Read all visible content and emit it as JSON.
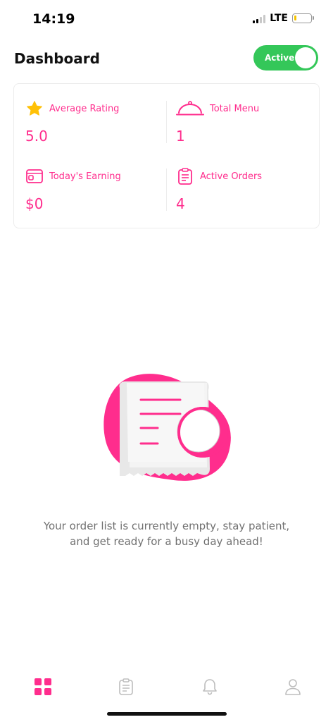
{
  "status_bar": {
    "time": "14:19",
    "network": "LTE",
    "battery_level": 0.15,
    "battery_color": "#f5c400"
  },
  "header": {
    "title": "Dashboard",
    "status_toggle": {
      "label": "Active",
      "on": true,
      "color": "#34c759"
    }
  },
  "stats": {
    "average_rating": {
      "label": "Average Rating",
      "value": "5.0",
      "icon": "star-icon"
    },
    "total_menu": {
      "label": "Total Menu",
      "value": "1",
      "icon": "cloche-icon"
    },
    "todays_earning": {
      "label": "Today's Earning",
      "value": "$0",
      "icon": "wallet-icon"
    },
    "active_orders": {
      "label": "Active Orders",
      "value": "4",
      "icon": "clipboard-icon"
    }
  },
  "empty_state": {
    "message": "Your order list is currently empty, stay patient, and get ready for a busy day ahead!",
    "illustration": "receipt-illustration"
  },
  "bottom_nav": {
    "items": [
      {
        "name": "dashboard",
        "icon": "grid-icon",
        "active": true
      },
      {
        "name": "orders",
        "icon": "clipboard-icon",
        "active": false
      },
      {
        "name": "notifications",
        "icon": "bell-icon",
        "active": false
      },
      {
        "name": "profile",
        "icon": "user-icon",
        "active": false
      }
    ]
  },
  "colors": {
    "accent": "#ff2d8d",
    "star": "#ffc107",
    "toggle_on": "#34c759",
    "inactive_icon": "#bdbdbd"
  }
}
